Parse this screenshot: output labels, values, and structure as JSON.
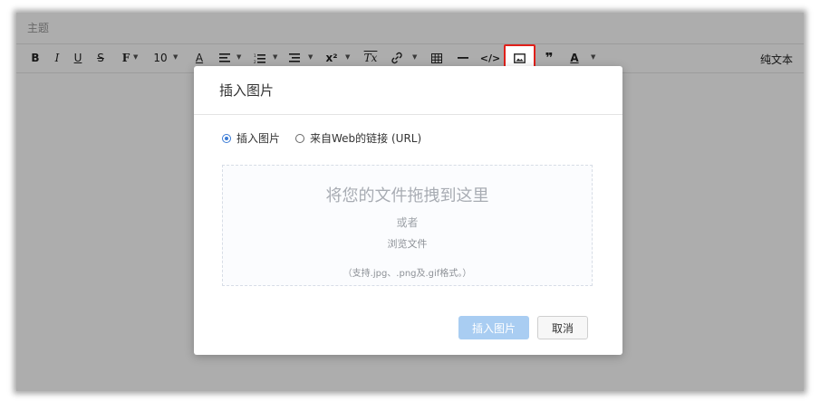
{
  "subject": {
    "placeholder": "主题"
  },
  "toolbar": {
    "bold": "B",
    "italic": "I",
    "underline": "U",
    "strike": "S",
    "font": "F",
    "font_size": "10",
    "font_color": "A",
    "superscript": "x²",
    "clear_format": "Tx",
    "code": "</>",
    "quote": "❞",
    "spellcheck": "A",
    "plain_text": "纯文本"
  },
  "dialog": {
    "title": "插入图片",
    "radio_options": [
      "插入图片",
      "来自Web的链接 (URL)"
    ],
    "selected_option": "插入图片",
    "dropzone": {
      "title": "将您的文件拖拽到这里",
      "or": "或者",
      "browse": "浏览文件",
      "hint": "（支持.jpg、.png及.gif格式。）"
    },
    "insert_button": "插入图片",
    "cancel_button": "取消"
  },
  "colors": {
    "highlight_border": "#e0201a",
    "primary_button_disabled": "#a9cdf2",
    "radio_accent": "#3a7bd5"
  }
}
